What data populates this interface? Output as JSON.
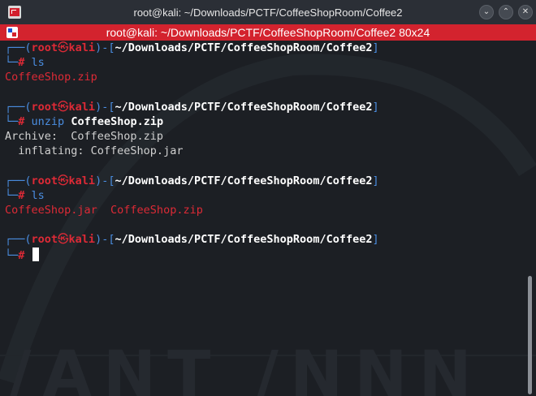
{
  "window": {
    "title": "root@kali: ~/Downloads/PCTF/CoffeeShopRoom/Coffee2",
    "buttons": {
      "minimize": "⌄",
      "maximize": "⌃",
      "close": "✕"
    }
  },
  "tab": {
    "label": "root@kali: ~/Downloads/PCTF/CoffeeShopRoom/Coffee2 80x24"
  },
  "prompt": {
    "corner_top": "┌──",
    "corner_bottom": "└─",
    "open_paren": "(",
    "user": "root",
    "at": "㉿",
    "host": "kali",
    "close_paren": ")",
    "dash": "-",
    "open_bracket": "[",
    "path": "~/Downloads/PCTF/CoffeeShopRoom/Coffee2",
    "close_bracket": "]",
    "symbol": "#"
  },
  "session": [
    {
      "command": "ls",
      "command_arg": "",
      "output": [
        {
          "text": "CoffeeShop.zip",
          "style": "red"
        }
      ]
    },
    {
      "command": "unzip",
      "command_arg": "CoffeeShop.zip",
      "output": [
        {
          "text": "Archive:  CoffeeShop.zip",
          "style": "plain"
        },
        {
          "text": "  inflating: CoffeeShop.jar",
          "style": "plain"
        }
      ]
    },
    {
      "command": "ls",
      "command_arg": "",
      "output": [
        {
          "text": "CoffeeShop.jar  CoffeeShop.zip",
          "style": "red"
        }
      ]
    }
  ],
  "colors": {
    "prompt_blue": "#4a8de0",
    "prompt_red": "#dd2a36",
    "tab_red": "#d3232e",
    "background": "#1c1f24"
  }
}
